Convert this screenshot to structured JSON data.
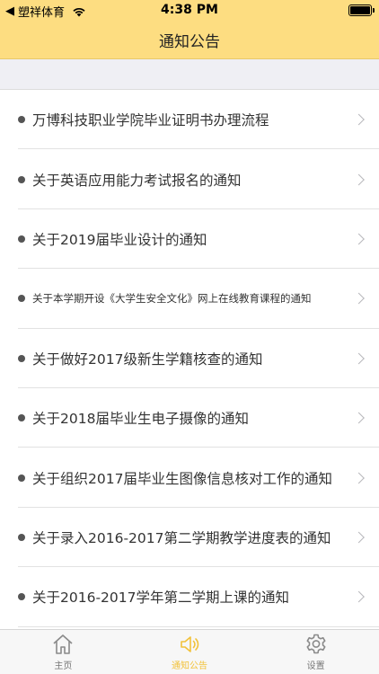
{
  "status_bar": {
    "back_glyph": "◀",
    "carrier": "塑祥体育",
    "time": "4:38 PM"
  },
  "nav": {
    "title": "通知公告"
  },
  "notices": [
    {
      "title": "万博科技职业学院毕业证明书办理流程"
    },
    {
      "title": "关于英语应用能力考试报名的通知"
    },
    {
      "title": "关于2019届毕业设计的通知"
    },
    {
      "title": "关于本学期开设《大学生安全文化》网上在线教育课程的通知"
    },
    {
      "title": "关于做好2017级新生学籍核查的通知"
    },
    {
      "title": "关于2018届毕业生电子摄像的通知"
    },
    {
      "title": "关于组织2017届毕业生图像信息核对工作的通知"
    },
    {
      "title": "关于录入2016-2017第二学期教学进度表的通知"
    },
    {
      "title": "关于2016-2017学年第二学期上课的通知"
    }
  ],
  "tabs": [
    {
      "label": "主页",
      "icon": "home-icon",
      "active": false
    },
    {
      "label": "通知公告",
      "icon": "speaker-icon",
      "active": true
    },
    {
      "label": "设置",
      "icon": "gear-icon",
      "active": false
    }
  ],
  "colors": {
    "header_bg": "#fddd81",
    "active_tab": "#f2c23a",
    "inactive_tab": "#777777"
  }
}
